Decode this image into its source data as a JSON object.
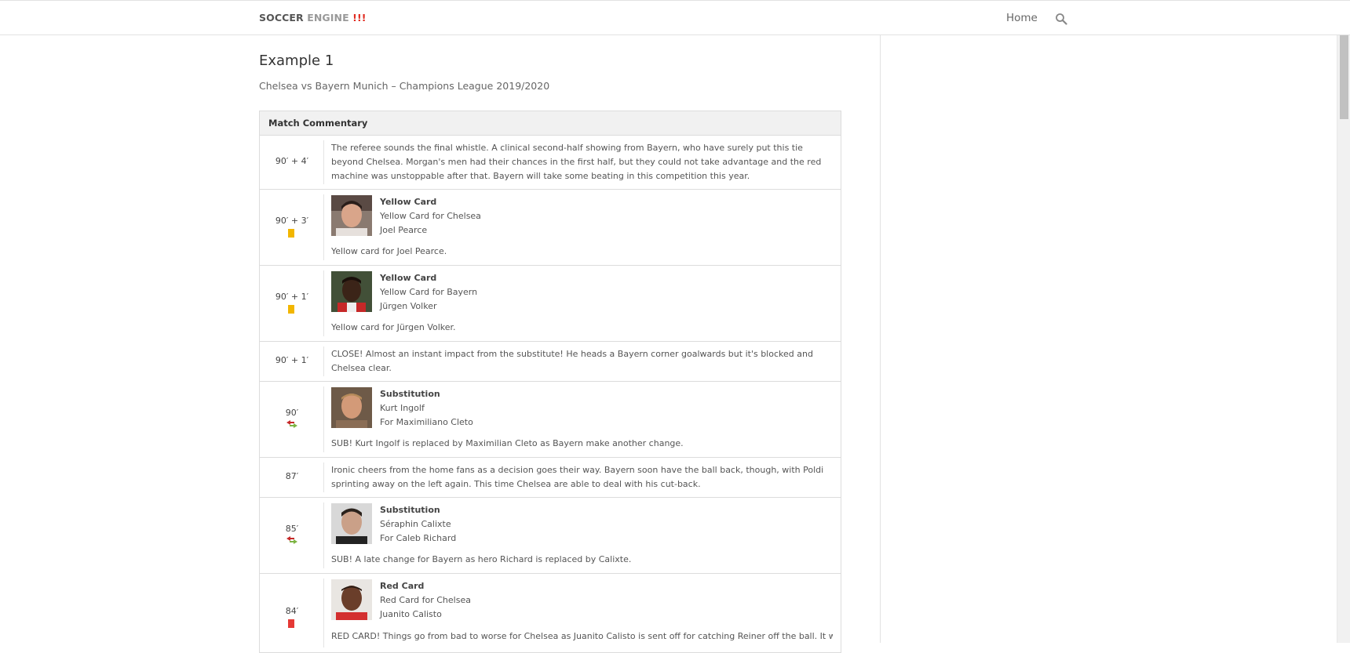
{
  "header": {
    "logo_part1": "SOCCER",
    "logo_part2": " ENGINE ",
    "logo_part3": "!!!",
    "nav_home": "Home",
    "search_icon": "search-icon"
  },
  "page": {
    "title": "Example 1",
    "subtitle": "Chelsea vs Bayern Munich – Champions League 2019/2020"
  },
  "commentary": {
    "header": "Match Commentary",
    "rows": [
      {
        "time": "90′ + 4′",
        "text": "The referee sounds the final whistle. A clinical second-half showing from Bayern, who have surely put this tie beyond Chelsea. Morgan's men had their chances in the first half, but they could not take advantage and the red machine was unstoppable after that. Bayern will take some beating in this competition this year."
      },
      {
        "time": "90′ + 3′",
        "icon": "yellow-card-icon",
        "event_title": "Yellow Card",
        "event_line1": "Yellow Card for Chelsea",
        "event_line2": "Joel Pearce",
        "text": "Yellow card for Joel Pearce."
      },
      {
        "time": "90′ + 1′",
        "icon": "yellow-card-icon",
        "event_title": "Yellow Card",
        "event_line1": "Yellow Card for Bayern",
        "event_line2": "Jürgen Volker",
        "text": "Yellow card for Jürgen Volker."
      },
      {
        "time": "90′ + 1′",
        "text": "CLOSE! Almost an instant impact from the substitute! He heads a Bayern corner goalwards but it's blocked and Chelsea clear."
      },
      {
        "time": "90′",
        "icon": "substitution-icon",
        "event_title": "Substitution",
        "event_line1": "Kurt Ingolf",
        "event_line2": "For Maximiliano Cleto",
        "text": "SUB! Kurt Ingolf is replaced by Maximilian Cleto as Bayern make another change."
      },
      {
        "time": "87′",
        "text": "Ironic cheers from the home fans as a decision goes their way. Bayern soon have the ball back, though, with Poldi sprinting away on the left again. This time Chelsea are able to deal with his cut-back."
      },
      {
        "time": "85′",
        "icon": "substitution-icon",
        "event_title": "Substitution",
        "event_line1": "Séraphin Calixte",
        "event_line2": "For Caleb Richard",
        "text": "SUB! A late change for Bayern as hero Richard is replaced by Calixte."
      },
      {
        "time": "84′",
        "icon": "red-card-icon",
        "event_title": "Red Card",
        "event_line1": "Red Card for Chelsea",
        "event_line2": "Juanito Calisto",
        "text": "RED CARD! Things go from bad to worse for Chelsea as Juanito Calisto is sent off for catching Reiner off the ball. It was"
      }
    ]
  },
  "colors": {
    "logo_accent": "#e02b20",
    "yellow_card": "#f2b600",
    "red_card": "#e53935",
    "sub_out": "#c62828",
    "sub_in": "#7cb342"
  }
}
